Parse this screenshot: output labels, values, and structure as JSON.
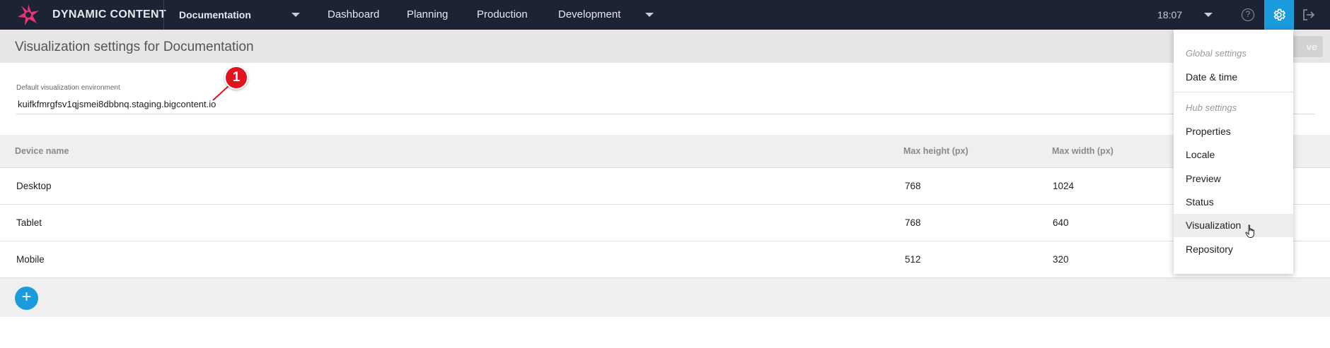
{
  "brand": {
    "name": "DYNAMIC CONTENT"
  },
  "topbar": {
    "hub_name": "Documentation",
    "nav": [
      "Dashboard",
      "Planning",
      "Production",
      "Development"
    ],
    "time": "18:07",
    "help_icon_glyph": "?",
    "accent_color": "#1a9bdb"
  },
  "page": {
    "title": "Visualization settings for Documentation",
    "save_label": "ve"
  },
  "environment": {
    "label": "Default visualization environment",
    "value": "kuifkfmrgfsv1qjsmei8dbbnq.staging.bigcontent.io"
  },
  "annotation": {
    "number": "1"
  },
  "table": {
    "headers": [
      "Device name",
      "Max height (px)",
      "Max width (px)"
    ],
    "rows": [
      [
        "Desktop",
        "768",
        "1024"
      ],
      [
        "Tablet",
        "768",
        "640"
      ],
      [
        "Mobile",
        "512",
        "320"
      ]
    ]
  },
  "add_button": {
    "glyph": "+"
  },
  "menu": {
    "global_heading": "Global settings",
    "global_items": [
      "Date & time"
    ],
    "hub_heading": "Hub settings",
    "hub_items": [
      "Properties",
      "Locale",
      "Preview",
      "Status",
      "Visualization",
      "Repository"
    ],
    "active_item": "Visualization"
  }
}
